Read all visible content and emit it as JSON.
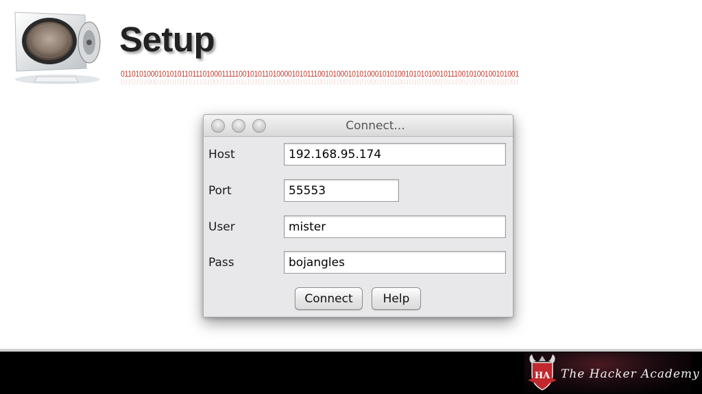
{
  "slide": {
    "title": "Setup",
    "binary_text": "0110101000101010110111010001111100101011010000101011100101000101010001010100101010100101110010100100101001"
  },
  "dialog": {
    "title": "Connect...",
    "fields": [
      {
        "label": "Host",
        "value": "192.168.95.174"
      },
      {
        "label": "Port",
        "value": "55553"
      },
      {
        "label": "User",
        "value": "mister"
      },
      {
        "label": "Pass",
        "value": "bojangles"
      }
    ],
    "buttons": {
      "connect": "Connect",
      "help": "Help"
    }
  },
  "footer": {
    "brand": "The Hacker Academy",
    "crest_initials": "HA",
    "colors": {
      "crest": "#c0282d",
      "bar": "#000000"
    }
  },
  "icons": [
    "vault-monitor-icon",
    "window-close-icon",
    "window-minimize-icon",
    "window-zoom-icon",
    "crest-icon"
  ]
}
